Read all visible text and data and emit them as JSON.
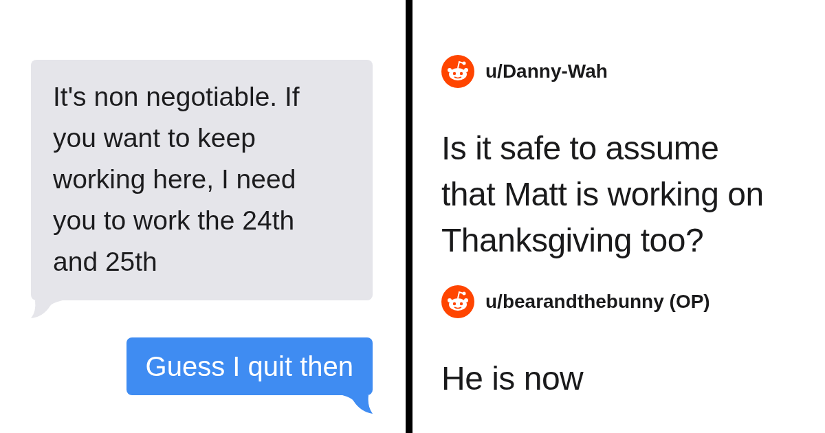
{
  "messages": [
    {
      "kind": "received",
      "text": "It's non negotiable. If you want to keep working here, I need you to work the 24th and 25th"
    },
    {
      "kind": "sent",
      "text": "Guess I quit then"
    }
  ],
  "comments": [
    {
      "username": "u/Danny-Wah",
      "text": "Is it safe to assume that Matt is working on Thanksgiving too?"
    },
    {
      "username": "u/bearandthebunny (OP)",
      "text": "He is now"
    }
  ]
}
